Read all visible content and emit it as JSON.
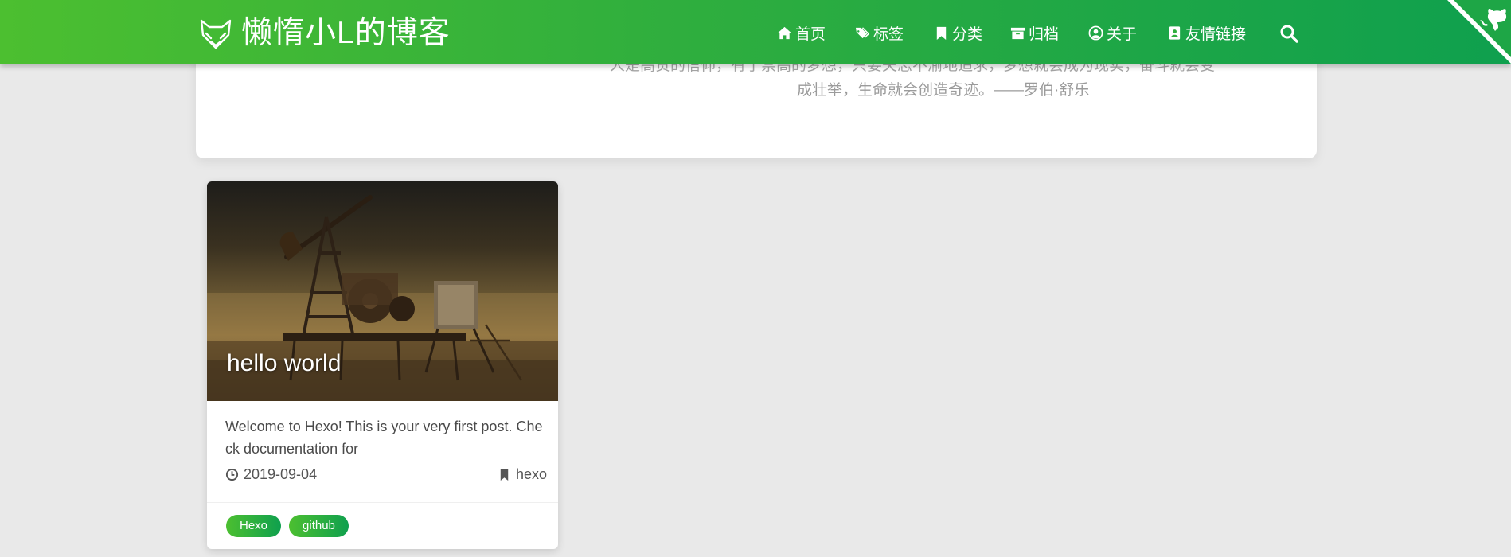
{
  "header": {
    "site_title": "懒惰小L的博客",
    "nav": [
      {
        "label": "首页",
        "icon": "home-icon"
      },
      {
        "label": "标签",
        "icon": "tags-icon"
      },
      {
        "label": "分类",
        "icon": "bookmark-icon"
      },
      {
        "label": "归档",
        "icon": "archive-icon"
      },
      {
        "label": "关于",
        "icon": "user-circle-icon"
      },
      {
        "label": "友情链接",
        "icon": "address-book-icon"
      }
    ],
    "search_icon": "search-icon",
    "corner_icon": "github-octocat-icon"
  },
  "quote": {
    "line1": "人是高贵的信仰，有了崇高的梦想，只要矢志不渝地追求，梦想就会成为现实，奋斗就会变",
    "line2": "成壮举，生命就会创造奇迹。——罗伯·舒乐"
  },
  "post": {
    "title": "hello world",
    "excerpt": "Welcome to Hexo! This is your very first post. Check documentation for",
    "date": "2019-09-04",
    "category": "hexo",
    "tags": [
      "Hexo",
      "github"
    ]
  },
  "colors": {
    "header_start": "#4cbf30",
    "header_end": "#0fa04e",
    "background": "#e9e9e9"
  }
}
